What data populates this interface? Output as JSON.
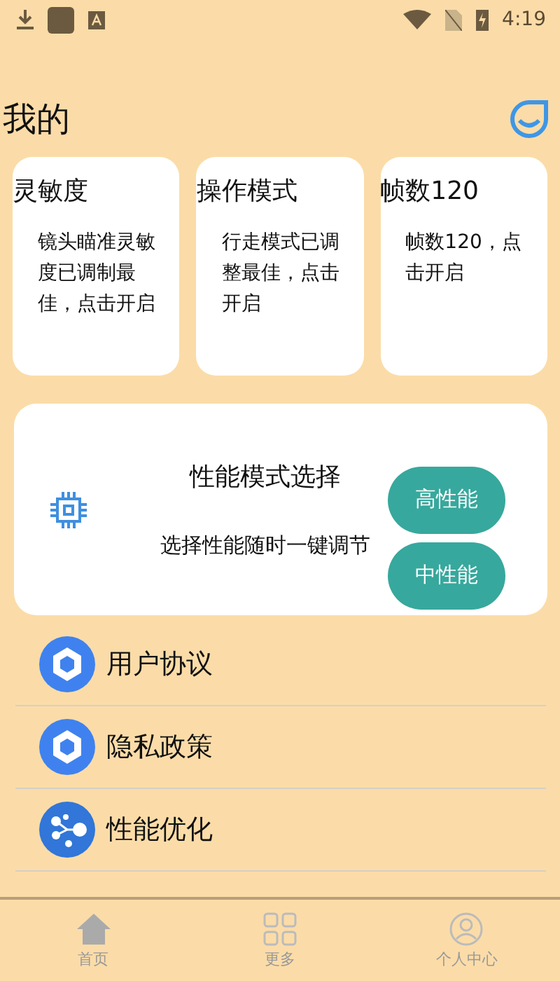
{
  "status_bar": {
    "time": "4:19"
  },
  "header": {
    "title": "我的"
  },
  "cards": [
    {
      "title": "灵敏度",
      "text": "镜头瞄准灵敏度已调制最佳，点击开启"
    },
    {
      "title": "操作模式",
      "text": "行走模式已调整最佳，点击开启"
    },
    {
      "title": "帧数120",
      "text": "帧数120，点击开启"
    }
  ],
  "performance": {
    "title": "性能模式选择",
    "subtitle": "选择性能随时一键调节",
    "buttons": [
      "高性能",
      "中性能"
    ]
  },
  "menu": [
    {
      "label": "用户协议",
      "kind": "shield"
    },
    {
      "label": "隐私政策",
      "kind": "shield"
    },
    {
      "label": "性能优化",
      "kind": "nodes"
    }
  ],
  "bottom_nav": [
    {
      "label": "首页",
      "kind": "home"
    },
    {
      "label": "更多",
      "kind": "grid"
    },
    {
      "label": "个人中心",
      "kind": "person"
    }
  ]
}
